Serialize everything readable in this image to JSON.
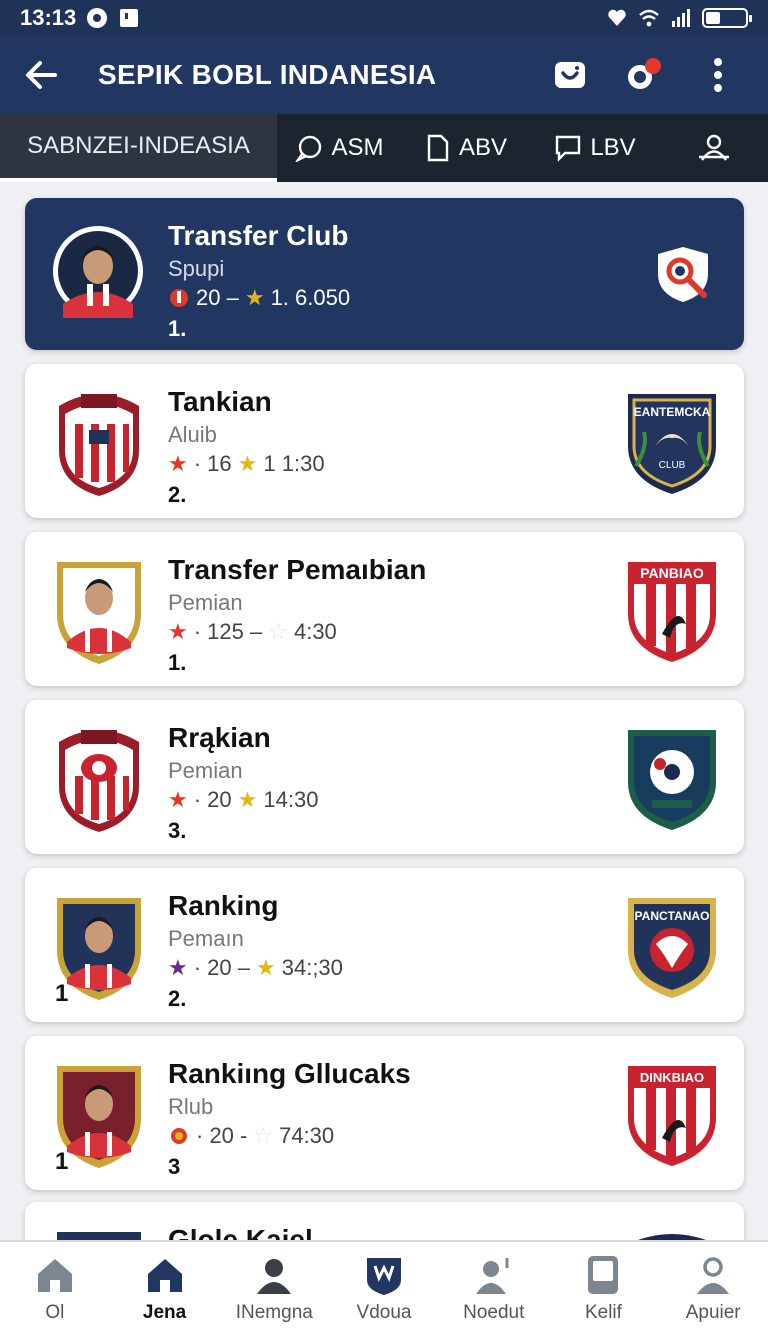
{
  "status_bar": {
    "time": "13:13"
  },
  "app_bar": {
    "title": "SEPIK BOBL INDANESIA"
  },
  "tabs": [
    {
      "label": "SABNZEI-INDEASIA",
      "icon": "none"
    },
    {
      "label": "ASM",
      "icon": "chat-icon"
    },
    {
      "label": "ABV",
      "icon": "document-icon"
    },
    {
      "label": "LBV",
      "icon": "comment-icon"
    },
    {
      "label": "",
      "icon": "person-group-icon"
    }
  ],
  "cards": [
    {
      "name": "Transfer Club",
      "sub": "Spupi",
      "stat1": "20 –",
      "stat2": "1. 6.050",
      "rank": "1.",
      "side": ""
    },
    {
      "name": "Tankian",
      "sub": "Aluib",
      "stat1": "· 16",
      "stat2": "1 1:30",
      "rank": "2.",
      "side": ""
    },
    {
      "name": "Transfer Pemaıbian",
      "sub": "Pemian",
      "stat1": "· 125 –",
      "stat2": "4:30",
      "rank": "1.",
      "side": ""
    },
    {
      "name": "Rrąkian",
      "sub": "Pemian",
      "stat1": "· 20",
      "stat2": "14:30",
      "rank": "3.",
      "side": ""
    },
    {
      "name": "Ranking",
      "sub": "Pemaın",
      "stat1": "· 20 –",
      "stat2": "34:;30",
      "rank": "2.",
      "side": "1"
    },
    {
      "name": "Rankiıng Gllucaks",
      "sub": "Rlub",
      "stat1": "· 20 -",
      "stat2": "74:30",
      "rank": "3",
      "side": "1"
    },
    {
      "name": "Glole Kaiel",
      "sub": "",
      "stat1": "",
      "stat2": "",
      "rank": "",
      "side": ""
    }
  ],
  "logos": {
    "tankian_right": "EANTEMCKA",
    "tankian_right_sub": "CLUB",
    "pemabian_right": "PANBIAO",
    "ranking_right": "PANCTANAO",
    "gllucaks_right": "DINKBIAO"
  },
  "bottom_nav": [
    {
      "label": "Ol",
      "icon": "home-icon"
    },
    {
      "label": "Jena",
      "icon": "home-filled-icon"
    },
    {
      "label": "INemgna",
      "icon": "person-icon"
    },
    {
      "label": "Vdoua",
      "icon": "shield-icon"
    },
    {
      "label": "Noedut",
      "icon": "person-add-icon"
    },
    {
      "label": "Kelif",
      "icon": "tablet-icon"
    },
    {
      "label": "Apuier",
      "icon": "profile-icon"
    }
  ],
  "colors": {
    "app_bar": "#213762",
    "tab_bar": "#1c2430",
    "accent_red": "#e0392b",
    "accent_gold": "#e2b713"
  }
}
